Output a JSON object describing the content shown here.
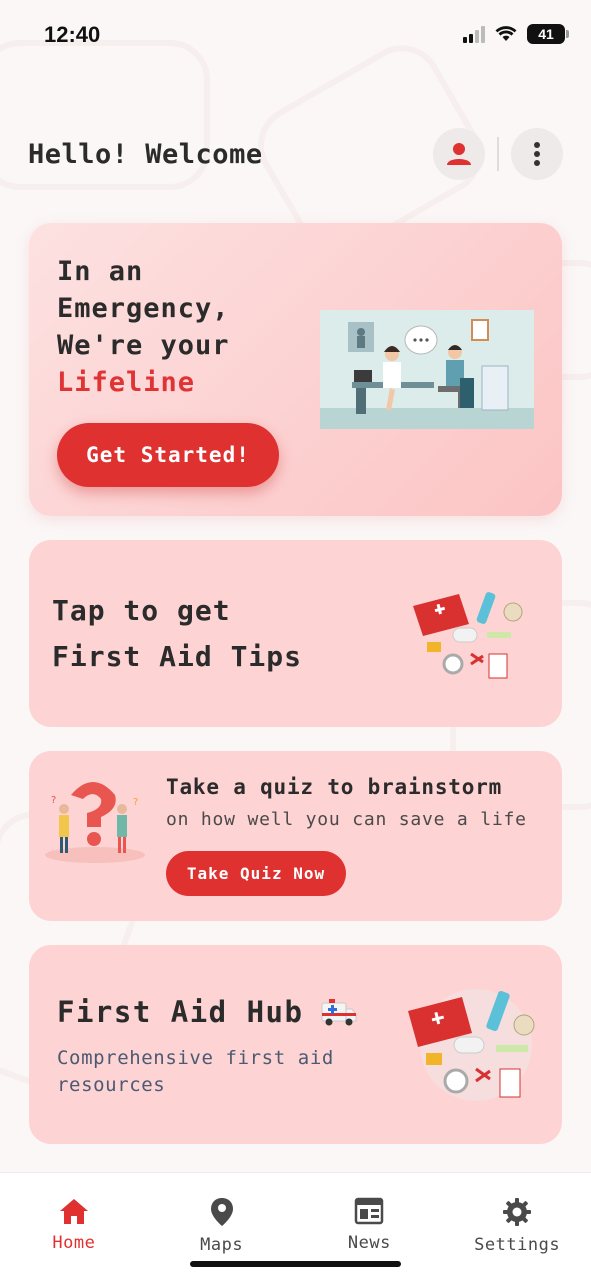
{
  "status_bar": {
    "time": "12:40",
    "battery": "41"
  },
  "header": {
    "greeting": "Hello! Welcome"
  },
  "hero": {
    "line1": "In an",
    "line2": "Emergency,",
    "line3": "We're your",
    "accent": "Lifeline",
    "button": "Get Started!"
  },
  "tips": {
    "line1": "Tap to get",
    "line2": "First Aid Tips"
  },
  "quiz": {
    "title": "Take a quiz to brainstorm",
    "subtitle": "on how well you can save a life",
    "button": "Take Quiz Now"
  },
  "hub": {
    "title": "First Aid Hub",
    "subtitle": "Comprehensive first aid resources"
  },
  "tabs": [
    {
      "label": "Home",
      "icon": "home-icon",
      "active": true
    },
    {
      "label": "Maps",
      "icon": "map-pin-icon",
      "active": false
    },
    {
      "label": "News",
      "icon": "news-icon",
      "active": false
    },
    {
      "label": "Settings",
      "icon": "gear-icon",
      "active": false
    }
  ],
  "colors": {
    "accent": "#e03131",
    "card": "#fdd3d3",
    "text": "#2b2b2b"
  }
}
